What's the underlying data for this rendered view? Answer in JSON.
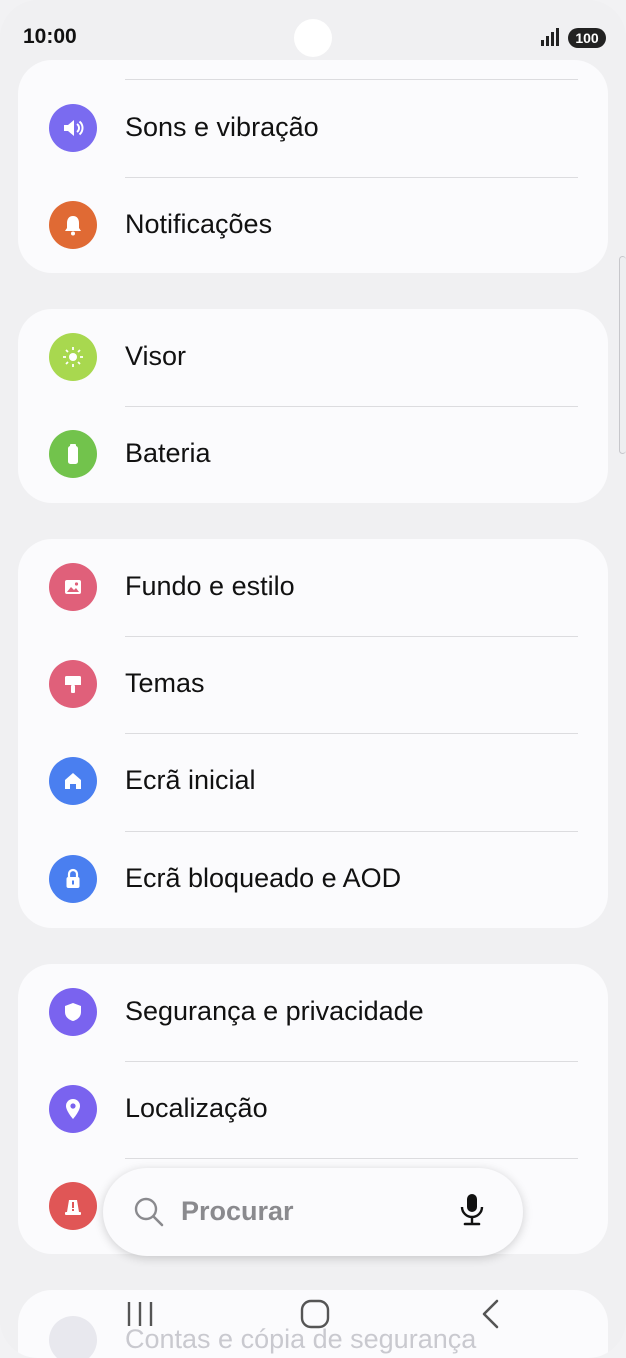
{
  "status": {
    "time": "10:00",
    "battery": "100"
  },
  "groups": [
    {
      "items": [
        {
          "label": "Sons e vibração",
          "icon": "speaker-icon",
          "color": "#7a6bf0"
        },
        {
          "label": "Notificações",
          "icon": "bell-icon",
          "color": "#e06a34"
        }
      ]
    },
    {
      "items": [
        {
          "label": "Visor",
          "icon": "sun-icon",
          "color": "#a8d84f"
        },
        {
          "label": "Bateria",
          "icon": "battery-icon",
          "color": "#72c34c"
        }
      ]
    },
    {
      "items": [
        {
          "label": "Fundo e estilo",
          "icon": "image-icon",
          "color": "#e0607a"
        },
        {
          "label": "Temas",
          "icon": "paint-brush-icon",
          "color": "#e0607a"
        },
        {
          "label": "Ecrã inicial",
          "icon": "home-icon",
          "color": "#4a7ff0"
        },
        {
          "label": "Ecrã bloqueado e AOD",
          "icon": "lock-icon",
          "color": "#4a7ff0"
        }
      ]
    },
    {
      "items": [
        {
          "label": "Segurança e privacidade",
          "icon": "shield-icon",
          "color": "#7a63ef"
        },
        {
          "label": "Localização",
          "icon": "location-pin-icon",
          "color": "#7a63ef"
        },
        {
          "label": "",
          "icon": "alert-icon",
          "color": "#e05656"
        }
      ]
    }
  ],
  "next_partial_label": "Contas e cópia de segurança",
  "search": {
    "placeholder": "Procurar"
  }
}
